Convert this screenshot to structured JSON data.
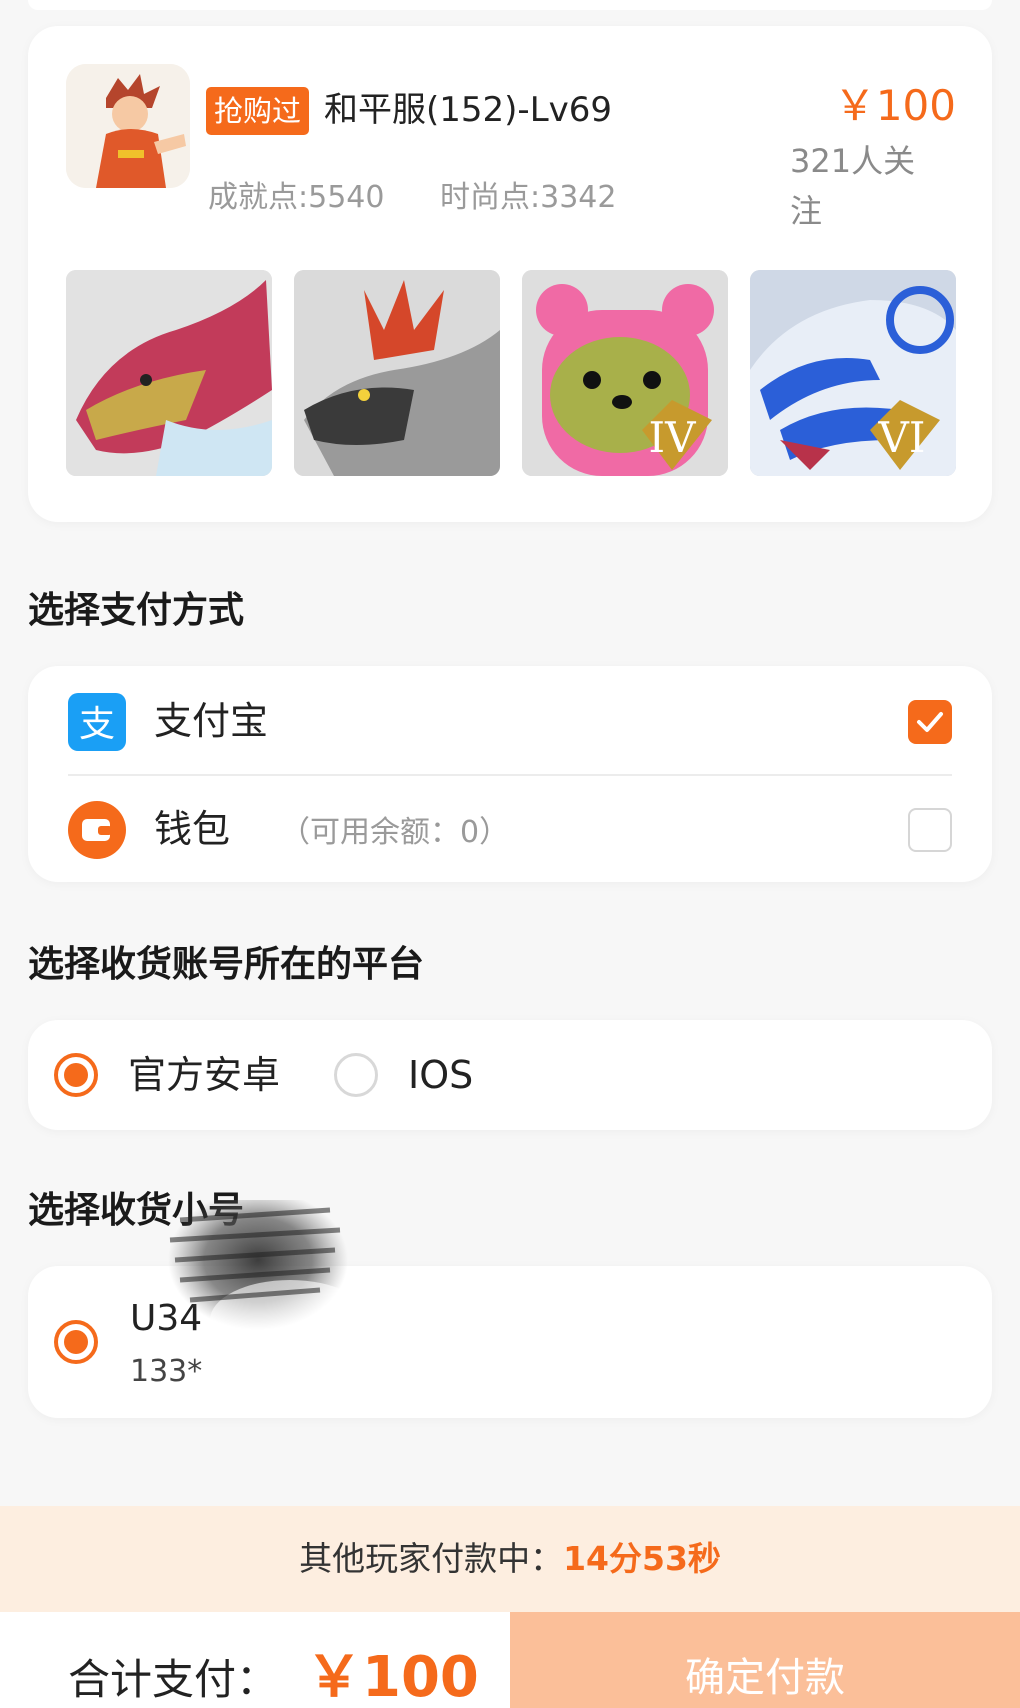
{
  "product": {
    "tag": "抢购过",
    "name": "和平服(152)-Lv69",
    "price": "￥100",
    "followers": "321人关注",
    "achievement_points": "成就点:5540",
    "fashion_points": "时尚点:3342",
    "thumb_badges": [
      "",
      "",
      "IV",
      "VI"
    ]
  },
  "payment": {
    "title": "选择支付方式",
    "alipay_label": "支付宝",
    "alipay_icon": "alipay-icon",
    "alipay_selected": true,
    "wallet_label": "钱包",
    "wallet_note": "（可用余额：0）",
    "wallet_icon": "wallet-icon",
    "wallet_selected": false
  },
  "platform": {
    "title": "选择收货账号所在的平台",
    "options": [
      {
        "label": "官方安卓",
        "selected": true
      },
      {
        "label": "IOS",
        "selected": false
      }
    ]
  },
  "account": {
    "title": "选择收货小号",
    "name": "U34",
    "sub": "133*",
    "selected": true
  },
  "banner": {
    "label": "其他玩家付款中：",
    "time": "14分53秒"
  },
  "footer": {
    "total_label": "合计支付：",
    "total_amount": "￥100",
    "confirm_label": "确定付款"
  },
  "colors": {
    "accent": "#f56a1b",
    "confirm_disabled": "#fbbf99",
    "banner_bg": "#fdeee0",
    "alipay_blue": "#1a9ff5"
  }
}
